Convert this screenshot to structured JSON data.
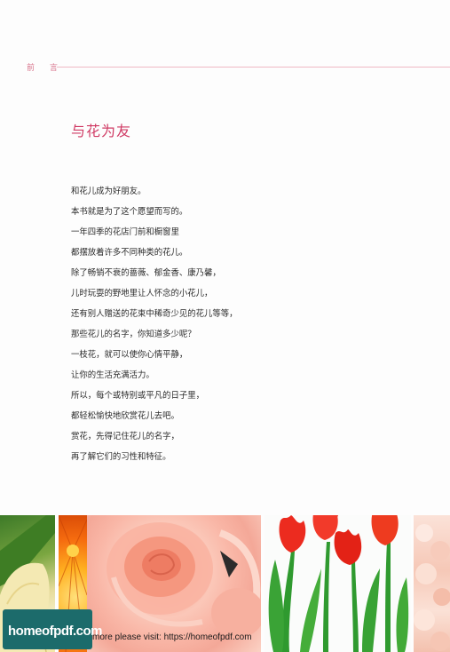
{
  "header": {
    "section_label": "前 言"
  },
  "main": {
    "title": "与花为友",
    "lines": [
      "和花儿成为好朋友。",
      "本书就是为了这个愿望而写的。",
      "一年四季的花店门前和橱窗里",
      "都摆放着许多不同种类的花儿。",
      "除了畅销不衰的蔷薇、郁金香、康乃馨，",
      "儿时玩耍的野地里让人怀念的小花儿，",
      "还有别人赠送的花束中稀奇少见的花儿等等，",
      "那些花儿的名字，你知道多少呢？",
      "一枝花，就可以使你心情平静，",
      "让你的生活充满活力。",
      "所以，每个或特别或平凡的日子里，",
      "都轻松愉快地欣赏花儿去吧。",
      "赏花，先得记住花儿的名字，",
      "再了解它们的习性和特征。"
    ]
  },
  "watermark": {
    "logo_text": "homeofpdf.com",
    "footer_text": "more please visit: https://homeofpdf.com",
    "badge_color": "#1c6b6b"
  },
  "colors": {
    "accent": "#d03a64",
    "rule": "#f0b8c4"
  }
}
